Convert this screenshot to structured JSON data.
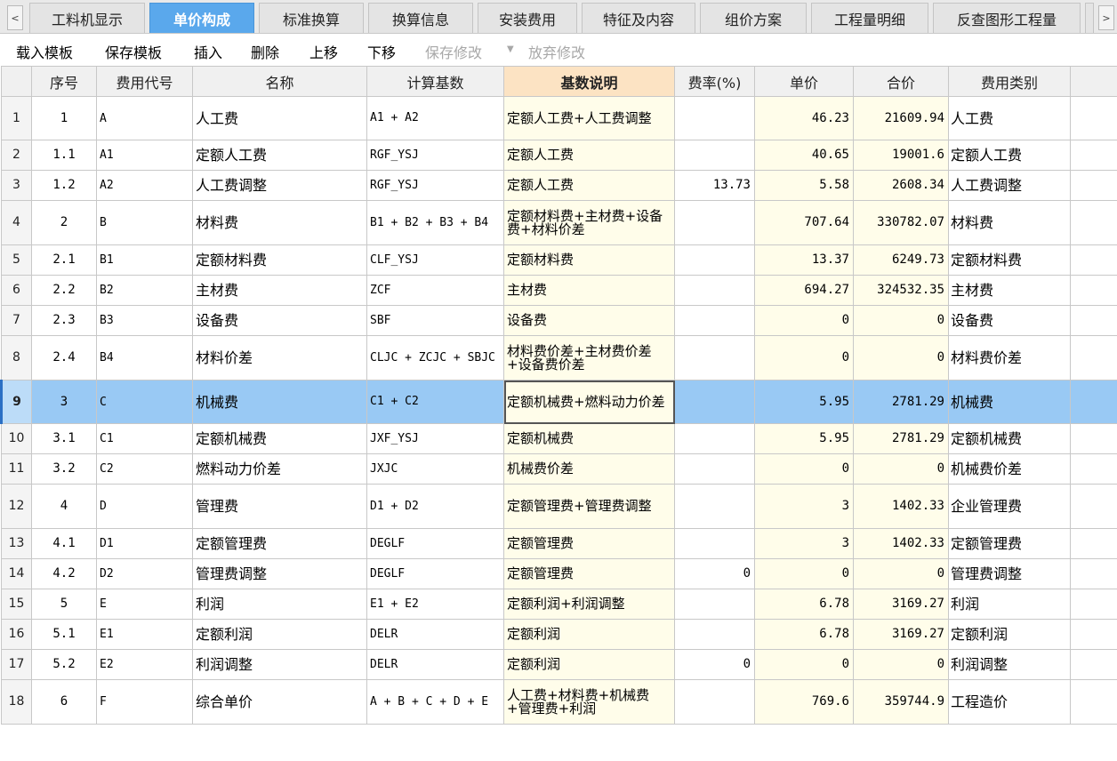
{
  "tabs": [
    {
      "label": "工料机显示",
      "active": false
    },
    {
      "label": "单价构成",
      "active": true
    },
    {
      "label": "标准换算",
      "active": false
    },
    {
      "label": "换算信息",
      "active": false
    },
    {
      "label": "安装费用",
      "active": false
    },
    {
      "label": "特征及内容",
      "active": false
    },
    {
      "label": "组价方案",
      "active": false
    },
    {
      "label": "工程量明细",
      "active": false
    },
    {
      "label": "反查图形工程量",
      "active": false
    }
  ],
  "tab_nav": {
    "left": "<",
    "right": ">"
  },
  "toolbar": {
    "load_template": "载入模板",
    "save_template": "保存模板",
    "insert": "插入",
    "delete": "删除",
    "move_up": "上移",
    "move_down": "下移",
    "save_changes": "保存修改",
    "dropdown_arrow": "▼",
    "discard_changes": "放弃修改"
  },
  "columns": [
    "",
    "序号",
    "费用代号",
    "名称",
    "计算基数",
    "基数说明",
    "费率(%)",
    "单价",
    "合价",
    "费用类别",
    ""
  ],
  "rows": [
    {
      "n": "1",
      "seq": "1",
      "code": "A",
      "name": "人工费",
      "base": "A1 + A2",
      "desc": "定额人工费+人工费调整",
      "rate": "",
      "price": "46.23",
      "total": "21609.94",
      "cat": "人工费"
    },
    {
      "n": "2",
      "seq": "1.1",
      "code": "A1",
      "name": "定额人工费",
      "base": "RGF_YSJ",
      "desc": "定额人工费",
      "rate": "",
      "price": "40.65",
      "total": "19001.6",
      "cat": "定额人工费"
    },
    {
      "n": "3",
      "seq": "1.2",
      "code": "A2",
      "name": "人工费调整",
      "base": "RGF_YSJ",
      "desc": "定额人工费",
      "rate": "13.73",
      "price": "5.58",
      "total": "2608.34",
      "cat": "人工费调整"
    },
    {
      "n": "4",
      "seq": "2",
      "code": "B",
      "name": "材料费",
      "base": "B1 + B2 + B3 + B4",
      "desc": "定额材料费+主材费+设备费+材料价差",
      "rate": "",
      "price": "707.64",
      "total": "330782.07",
      "cat": "材料费"
    },
    {
      "n": "5",
      "seq": "2.1",
      "code": "B1",
      "name": "定额材料费",
      "base": "CLF_YSJ",
      "desc": "定额材料费",
      "rate": "",
      "price": "13.37",
      "total": "6249.73",
      "cat": "定额材料费"
    },
    {
      "n": "6",
      "seq": "2.2",
      "code": "B2",
      "name": "主材费",
      "base": "ZCF",
      "desc": "主材费",
      "rate": "",
      "price": "694.27",
      "total": "324532.35",
      "cat": "主材费"
    },
    {
      "n": "7",
      "seq": "2.3",
      "code": "B3",
      "name": "设备费",
      "base": "SBF",
      "desc": "设备费",
      "rate": "",
      "price": "0",
      "total": "0",
      "cat": "设备费"
    },
    {
      "n": "8",
      "seq": "2.4",
      "code": "B4",
      "name": "材料价差",
      "base": "CLJC + ZCJC + SBJC",
      "desc": "材料费价差+主材费价差+设备费价差",
      "rate": "",
      "price": "0",
      "total": "0",
      "cat": "材料费价差"
    },
    {
      "n": "9",
      "seq": "3",
      "code": "C",
      "name": "机械费",
      "base": "C1 + C2",
      "desc": "定额机械费+燃料动力价差",
      "rate": "",
      "price": "5.95",
      "total": "2781.29",
      "cat": "机械费",
      "selected": true
    },
    {
      "n": "10",
      "seq": "3.1",
      "code": "C1",
      "name": "定额机械费",
      "base": "JXF_YSJ",
      "desc": "定额机械费",
      "rate": "",
      "price": "5.95",
      "total": "2781.29",
      "cat": "定额机械费"
    },
    {
      "n": "11",
      "seq": "3.2",
      "code": "C2",
      "name": "燃料动力价差",
      "base": "JXJC",
      "desc": "机械费价差",
      "rate": "",
      "price": "0",
      "total": "0",
      "cat": "机械费价差"
    },
    {
      "n": "12",
      "seq": "4",
      "code": "D",
      "name": "管理费",
      "base": "D1 + D2",
      "desc": "定额管理费+管理费调整",
      "rate": "",
      "price": "3",
      "total": "1402.33",
      "cat": "企业管理费"
    },
    {
      "n": "13",
      "seq": "4.1",
      "code": "D1",
      "name": "定额管理费",
      "base": "DEGLF",
      "desc": "定额管理费",
      "rate": "",
      "price": "3",
      "total": "1402.33",
      "cat": "定额管理费"
    },
    {
      "n": "14",
      "seq": "4.2",
      "code": "D2",
      "name": "管理费调整",
      "base": "DEGLF",
      "desc": "定额管理费",
      "rate": "0",
      "price": "0",
      "total": "0",
      "cat": "管理费调整"
    },
    {
      "n": "15",
      "seq": "5",
      "code": "E",
      "name": "利润",
      "base": "E1 + E2",
      "desc": "定额利润+利润调整",
      "rate": "",
      "price": "6.78",
      "total": "3169.27",
      "cat": "利润"
    },
    {
      "n": "16",
      "seq": "5.1",
      "code": "E1",
      "name": "定额利润",
      "base": "DELR",
      "desc": "定额利润",
      "rate": "",
      "price": "6.78",
      "total": "3169.27",
      "cat": "定额利润"
    },
    {
      "n": "17",
      "seq": "5.2",
      "code": "E2",
      "name": "利润调整",
      "base": "DELR",
      "desc": "定额利润",
      "rate": "0",
      "price": "0",
      "total": "0",
      "cat": "利润调整"
    },
    {
      "n": "18",
      "seq": "6",
      "code": "F",
      "name": "综合单价",
      "base": "A + B + C + D + E",
      "desc": "人工费+材料费+机械费+管理费+利润",
      "rate": "",
      "price": "769.6",
      "total": "359744.9",
      "cat": "工程造价"
    }
  ],
  "colors": {
    "active_tab": "#5aa8ec",
    "selected_row": "#99c9f4",
    "highlight_header": "#fce3c3",
    "editable_cell": "#fffdea"
  }
}
